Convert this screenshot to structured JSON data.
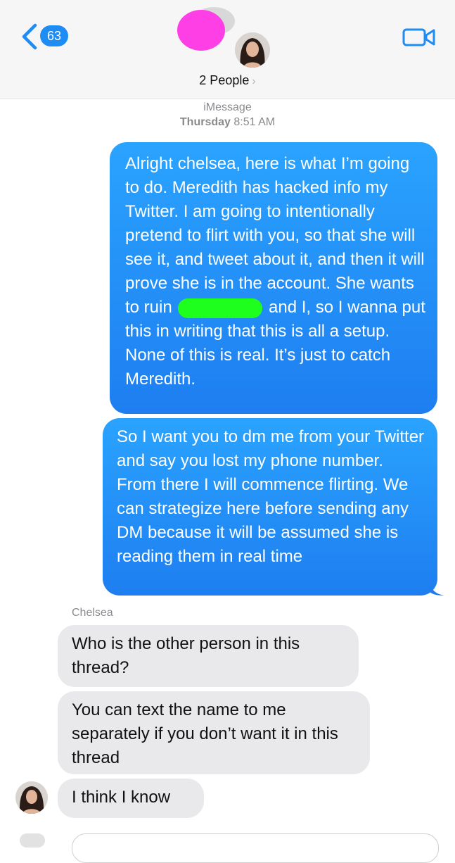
{
  "header": {
    "back_count": "63",
    "group_label": "2 People",
    "chevron": "›",
    "icons": {
      "back": "chevron-left-icon",
      "video": "video-camera-icon"
    }
  },
  "thread": {
    "service": "iMessage",
    "day": "Thursday",
    "time": "8:51 AM"
  },
  "messages": [
    {
      "from": "me",
      "text_before": "Alright chelsea, here is what I’m going to do. Meredith has hacked info my Twitter. I am going to intentionally pretend to flirt with you, so that she will see it, and tweet about it, and then it will prove she is in the account. She wants to ruin",
      "text_after": "and I, so I wanna put this in writing that this is all a setup. None of this is real. It’s just to catch Meredith."
    },
    {
      "from": "me",
      "text": "So I want you to dm me from your Twitter and say you lost my phone number. From there I will commence flirting. We can strategize here before sending any DM because it will be assumed she is reading them in real time"
    },
    {
      "from": "Chelsea",
      "text": "Who is the other person in this thread?"
    },
    {
      "from": "Chelsea",
      "text": "You can text the name to me separately if you don’t want it in this thread"
    },
    {
      "from": "Chelsea",
      "text": "I think I know"
    }
  ],
  "sender_name": "Chelsea",
  "colors": {
    "sent_bubble": "#1e8cf5",
    "received_bubble": "#e9e9eb",
    "redaction_pink": "#ff3fe6",
    "redaction_green": "#1eff1e"
  }
}
